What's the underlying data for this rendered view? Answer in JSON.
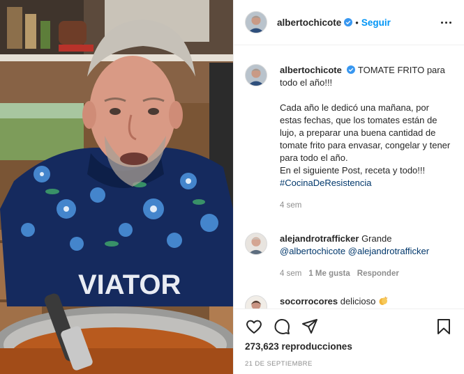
{
  "header": {
    "username": "albertochicote",
    "separator": "•",
    "follow_label": "Seguir",
    "verified_icon": "verified-badge-icon",
    "more_icon": "more-options-icon"
  },
  "caption": {
    "username": "albertochicote",
    "text": "TOMATE FRITO para todo el año!!!\n\nCada año le dedicó una mañana, por estas fechas, que los tomates están de lujo, a preparar una buena cantidad de tomate frito para envasar, congelar y tener para todo el año.\nEn el siguiente Post, receta y todo!!!",
    "hashtag": "#CocinaDeResistencia",
    "time": "4 sem"
  },
  "comments": [
    {
      "username": "alejandrotrafficker",
      "text": "Grande",
      "mention1": "@albertochicote",
      "mention2": "@alejandrotrafficker",
      "time": "4 sem",
      "likes": "1 Me gusta",
      "reply_label": "Responder"
    },
    {
      "username": "socorrocores",
      "text": "delicioso"
    }
  ],
  "actions": {
    "icons": [
      "heart-icon",
      "comment-icon",
      "share-icon",
      "bookmark-icon"
    ],
    "views": "273,623 reproducciones",
    "date": "21 DE SEPTIEMBRE"
  },
  "media": {
    "jersey_text": "VIATOR"
  },
  "colors": {
    "accent": "#0095f6",
    "link": "#00376b",
    "muted": "#8e8e8e",
    "text": "#262626"
  }
}
